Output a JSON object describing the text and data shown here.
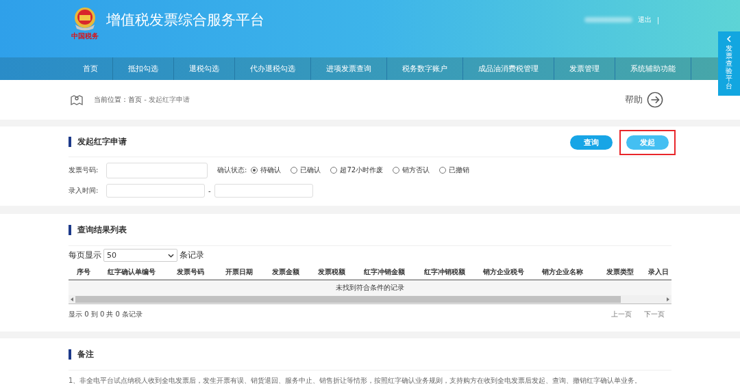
{
  "header": {
    "logo_caption": "中国税务",
    "title": "增值税发票综合服务平台",
    "logout": "退出",
    "separator": "|"
  },
  "nav": [
    "首页",
    "抵扣勾选",
    "退税勾选",
    "代办退税勾选",
    "进项发票查询",
    "税务数字账户",
    "成品油消费税管理",
    "发票管理",
    "系统辅助功能"
  ],
  "side_tab": {
    "label": "发票查验平台"
  },
  "breadcrumb": {
    "prefix": "当前位置：",
    "home": "首页",
    "current": " - 发起红字申请",
    "help": "帮助"
  },
  "form": {
    "title": "发起红字申请",
    "buttons": [
      {
        "label": "查询",
        "highlighted": false
      },
      {
        "label": "发起",
        "highlighted": true
      }
    ],
    "invoice_no_label": "发票号码:",
    "status_label": "确认状态:",
    "statuses": [
      {
        "label": "待确认",
        "selected": true
      },
      {
        "label": "已确认",
        "selected": false
      },
      {
        "label": "超72小时作废",
        "selected": false
      },
      {
        "label": "销方否认",
        "selected": false
      },
      {
        "label": "已撤销",
        "selected": false
      }
    ],
    "time_label": "录入时间:",
    "range_sep": "-"
  },
  "results": {
    "title": "查询结果列表",
    "page_size_prefix": "每页显示",
    "page_size": "50",
    "page_size_suffix": "条记录",
    "columns": [
      "序号",
      "红字确认单编号",
      "发票号码",
      "开票日期",
      "发票金额",
      "发票税额",
      "红字冲销金额",
      "红字冲销税额",
      "销方企业税号",
      "销方企业名称",
      "发票类型",
      "录入日"
    ],
    "empty": "未找到符合条件的记录",
    "summary": "显示 0 到 0 共 0 条记录",
    "prev": "上一页",
    "next": "下一页"
  },
  "notes": {
    "title": "备注",
    "items": [
      "1、非全电平台试点纳税人收到全电发票后，发生开票有误、销货退回、服务中止、销售折让等情形，按照红字确认业务规则，支持购方在收到全电发票后发起、查询、撤销红字确认单业务。"
    ]
  }
}
